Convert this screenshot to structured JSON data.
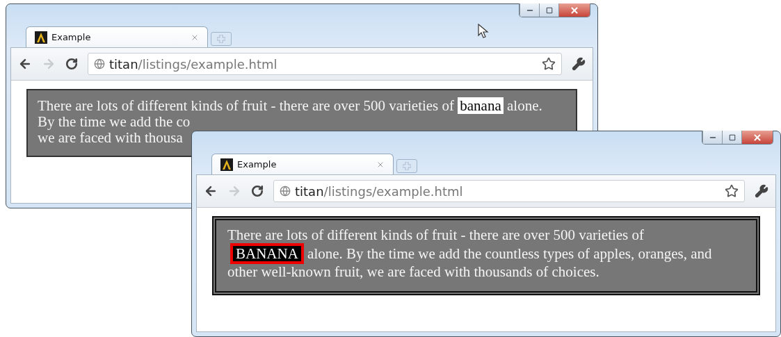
{
  "windows": [
    {
      "tabs": [
        {
          "title": "Example",
          "selected": true
        }
      ],
      "nav": {
        "back_enabled": true,
        "forward_enabled": false
      },
      "address": {
        "host": "titan",
        "path": "/listings/example.html"
      },
      "content_box": {
        "kind": "solid"
      },
      "lines": [
        {
          "parts": [
            {
              "text": "There are lots of different kinds of fruit - there are over 500 varieties of ",
              "kind": "plain"
            },
            {
              "text": "banana",
              "kind": "light"
            },
            {
              "text": " alone.",
              "kind": "plain"
            }
          ]
        },
        {
          "parts": [
            {
              "text": "By the time we add the co",
              "kind": "plain"
            }
          ]
        },
        {
          "parts": [
            {
              "text": "we are faced with thousa",
              "kind": "plain"
            }
          ]
        }
      ],
      "cursor": true
    },
    {
      "tabs": [
        {
          "title": "Example",
          "selected": true
        }
      ],
      "nav": {
        "back_enabled": true,
        "forward_enabled": false
      },
      "address": {
        "host": "titan",
        "path": "/listings/example.html"
      },
      "content_box": {
        "kind": "double"
      },
      "paragraph": {
        "parts": [
          {
            "text": "There are lots of different kinds of fruit - there are over 500 varieties of ",
            "kind": "plain"
          },
          {
            "text": "BANANA",
            "kind": "boxed"
          },
          {
            "text": " alone. By the time we add the countless types of apples, oranges, and other well-known fruit, we are faced with thousands of choices.",
            "kind": "plain"
          }
        ]
      }
    }
  ]
}
